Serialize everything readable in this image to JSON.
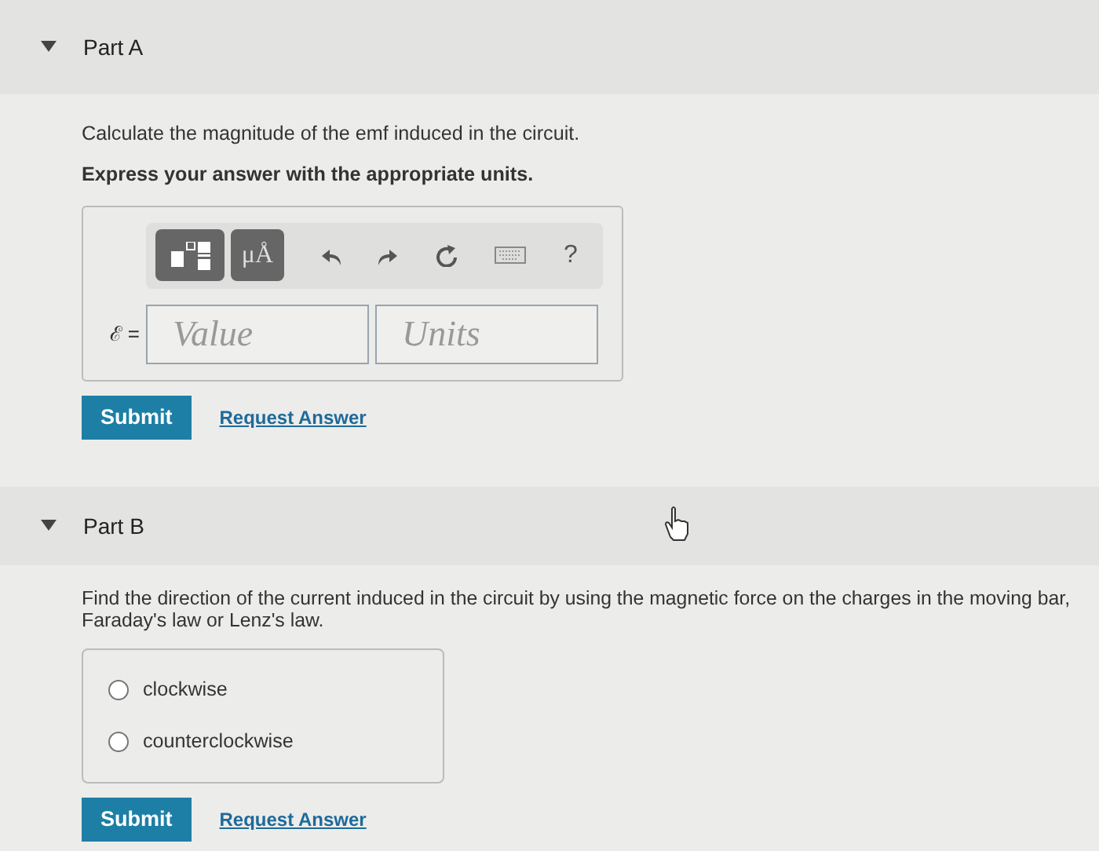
{
  "parts": [
    {
      "title": "Part A",
      "expanded": true,
      "kind": "answer",
      "prompt": "Calculate the magnitude of the emf induced in the circuit.",
      "instruction": "Express your answer with the appropriate units.",
      "toolbar": {
        "units_button": "μÅ",
        "help": "?"
      },
      "variable": "ℰ =",
      "value_field": {
        "placeholder": "Value"
      },
      "units_field": {
        "placeholder": "Units"
      },
      "submit": "Submit",
      "request": "Request Answer"
    },
    {
      "title": "Part B",
      "expanded": true,
      "kind": "choice",
      "prompt": "Find the direction of the current induced in the circuit by using the magnetic force on the charges in the moving bar, Faraday's law or Lenz's law.",
      "options": [
        {
          "label": "clockwise",
          "selected": false
        },
        {
          "label": "counterclockwise",
          "selected": false
        }
      ],
      "submit": "Submit",
      "request": "Request Answer"
    }
  ]
}
